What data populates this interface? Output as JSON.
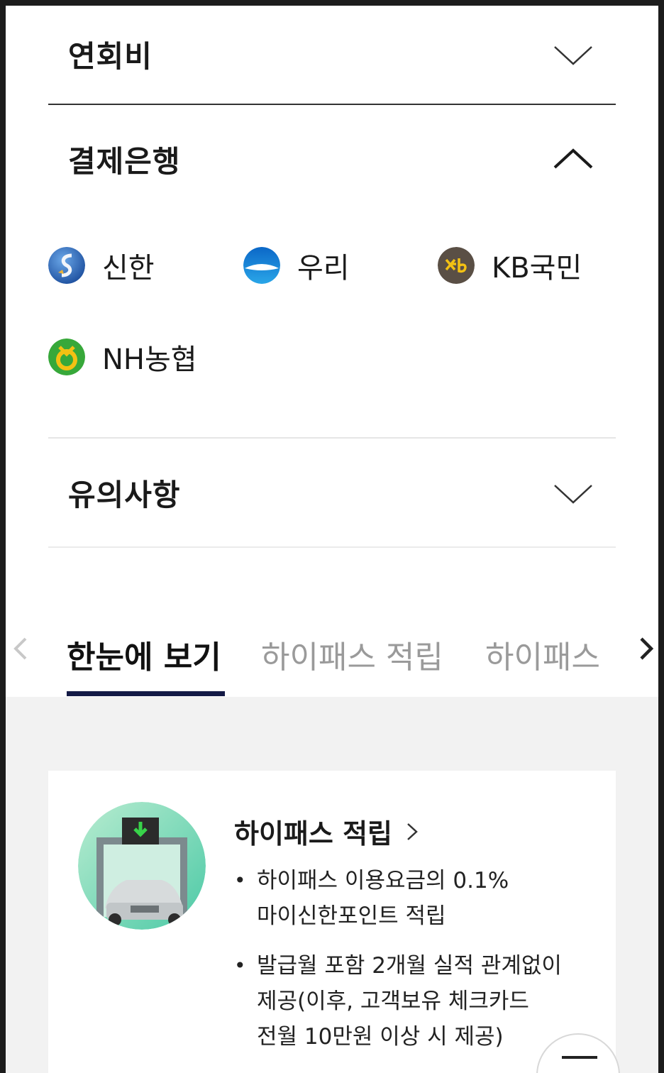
{
  "accordion": {
    "annual_fee": {
      "title": "연회비",
      "expanded": false
    },
    "payment_bank": {
      "title": "결제은행",
      "expanded": true
    },
    "notes": {
      "title": "유의사항",
      "expanded": false
    }
  },
  "banks": [
    {
      "name": "신한",
      "icon": "shinhan-logo-icon"
    },
    {
      "name": "우리",
      "icon": "woori-logo-icon"
    },
    {
      "name": "KB국민",
      "icon": "kb-logo-icon"
    },
    {
      "name": "NH농협",
      "icon": "nh-logo-icon"
    }
  ],
  "tabs": [
    {
      "label": "한눈에 보기",
      "active": true
    },
    {
      "label": "하이패스 적립",
      "active": false
    },
    {
      "label": "하이패스",
      "active": false
    }
  ],
  "card": {
    "title": "하이패스 적립",
    "bullets": [
      {
        "line1": "하이패스 이용요금의 0.1%",
        "line2": "마이신한포인트 적립"
      },
      {
        "line1": "발급월 포함 2개월 실적 관계없이",
        "line2": "제공(이후, 고객보유 체크카드",
        "line3": "전월 10만원 이상 시 제공)"
      }
    ]
  },
  "colors": {
    "tab_underline": "#141a46",
    "gray_bg": "#f2f2f2"
  }
}
